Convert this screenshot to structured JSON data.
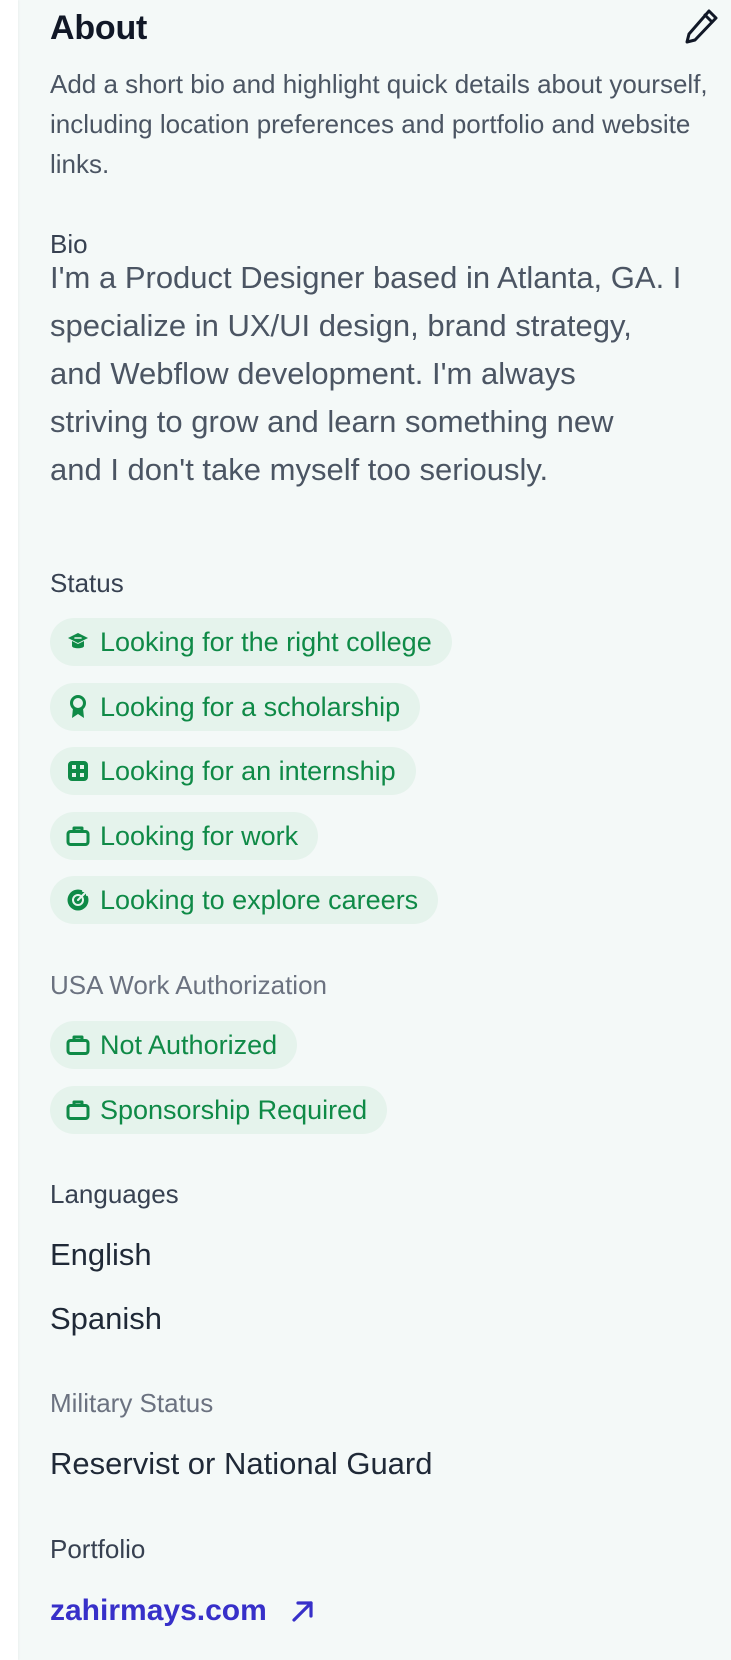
{
  "about": {
    "title": "About",
    "description": "Add a short bio and highlight quick details about yourself, including location preferences and portfolio and website links.",
    "edit_icon": "pencil-icon"
  },
  "bio": {
    "label": "Bio",
    "text": "I'm a Product Designer based in Atlanta, GA. I\nspecialize in UX/UI design, brand strategy,\nand Webflow development. I'm always\nstriving to grow and learn something new\nand I don't take myself too seriously."
  },
  "status": {
    "label": "Status",
    "chips": [
      {
        "label": "Looking for the right college",
        "icon": "graduation-cap-icon"
      },
      {
        "label": "Looking for a scholarship",
        "icon": "award-ribbon-icon"
      },
      {
        "label": "Looking for an internship",
        "icon": "id-badge-icon"
      },
      {
        "label": "Looking for work",
        "icon": "briefcase-icon"
      },
      {
        "label": "Looking to explore careers",
        "icon": "compass-target-icon"
      }
    ]
  },
  "work_authorization": {
    "label": "USA Work Authorization",
    "chips": [
      {
        "label": "Not Authorized",
        "icon": "briefcase-icon"
      },
      {
        "label": "Sponsorship Required",
        "icon": "briefcase-icon"
      }
    ]
  },
  "languages": {
    "label": "Languages",
    "items": [
      "English",
      "Spanish"
    ]
  },
  "military": {
    "label": "Military Status",
    "value": "Reservist or National Guard"
  },
  "portfolio": {
    "label": "Portfolio",
    "link_text": "zahirmays.com",
    "link_icon": "external-arrow-icon"
  },
  "colors": {
    "background": "#f4f9f8",
    "chip_bg": "#e5f3ec",
    "chip_text": "#0f8a47",
    "link": "#3730c9"
  }
}
